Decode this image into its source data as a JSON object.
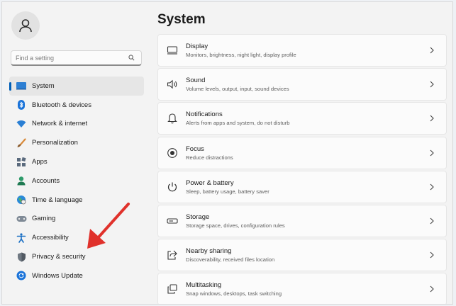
{
  "search": {
    "placeholder": "Find a setting"
  },
  "sidebar": {
    "items": [
      {
        "label": "System",
        "icon": "system-icon",
        "selected": true
      },
      {
        "label": "Bluetooth & devices",
        "icon": "bluetooth-icon"
      },
      {
        "label": "Network & internet",
        "icon": "wifi-icon"
      },
      {
        "label": "Personalization",
        "icon": "brush-icon"
      },
      {
        "label": "Apps",
        "icon": "apps-icon"
      },
      {
        "label": "Accounts",
        "icon": "accounts-icon"
      },
      {
        "label": "Time & language",
        "icon": "globe-clock-icon"
      },
      {
        "label": "Gaming",
        "icon": "gamepad-icon"
      },
      {
        "label": "Accessibility",
        "icon": "accessibility-icon"
      },
      {
        "label": "Privacy & security",
        "icon": "shield-icon"
      },
      {
        "label": "Windows Update",
        "icon": "update-icon"
      }
    ]
  },
  "main": {
    "title": "System",
    "cards": [
      {
        "title": "Display",
        "subtitle": "Monitors, brightness, night light, display profile",
        "icon": "monitor-icon"
      },
      {
        "title": "Sound",
        "subtitle": "Volume levels, output, input, sound devices",
        "icon": "speaker-icon"
      },
      {
        "title": "Notifications",
        "subtitle": "Alerts from apps and system, do not disturb",
        "icon": "bell-icon"
      },
      {
        "title": "Focus",
        "subtitle": "Reduce distractions",
        "icon": "focus-icon"
      },
      {
        "title": "Power & battery",
        "subtitle": "Sleep, battery usage, battery saver",
        "icon": "power-icon"
      },
      {
        "title": "Storage",
        "subtitle": "Storage space, drives, configuration rules",
        "icon": "storage-icon"
      },
      {
        "title": "Nearby sharing",
        "subtitle": "Discoverability, received files location",
        "icon": "share-icon"
      },
      {
        "title": "Multitasking",
        "subtitle": "Snap windows, desktops, task switching",
        "icon": "multitasking-icon"
      }
    ]
  },
  "colors": {
    "accent": "#005fb8",
    "annotation_arrow": "#e0312b"
  }
}
